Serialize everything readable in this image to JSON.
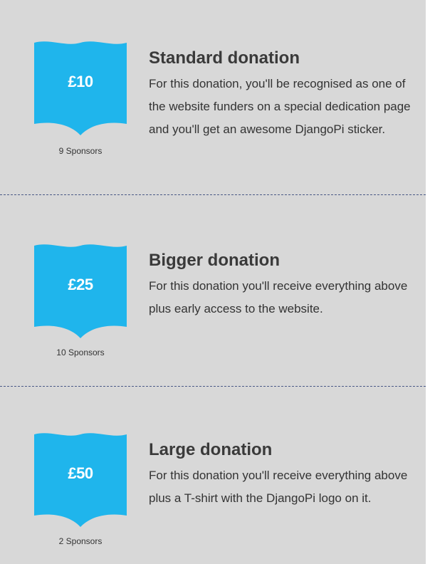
{
  "tiers": [
    {
      "amount": "£10",
      "sponsors": "9 Sponsors",
      "title": "Standard donation",
      "description": "For this donation, you'll be recognised as one of the website funders on a special dedication page and you'll get an awesome DjangoPi sticker."
    },
    {
      "amount": "£25",
      "sponsors": "10 Sponsors",
      "title": "Bigger donation",
      "description": "For this donation you'll receive everything above plus early access to the website."
    },
    {
      "amount": "£50",
      "sponsors": "2 Sponsors",
      "title": "Large donation",
      "description": "For this donation you'll receive everything above plus a T-shirt with the DjangoPi logo on it."
    }
  ],
  "colors": {
    "badge": "#1fb5ec",
    "background": "#d8d8d8",
    "separator": "#4a5a86"
  }
}
